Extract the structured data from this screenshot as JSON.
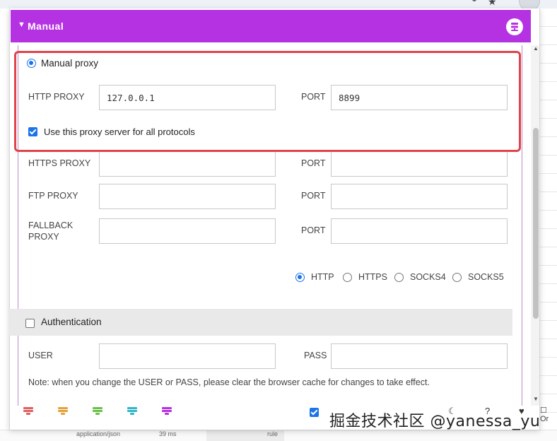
{
  "header": {
    "title": "Manual",
    "accent": "#b532e3"
  },
  "mode": {
    "manual_label": "Manual proxy",
    "selected": true
  },
  "http": {
    "label": "HTTP PROXY",
    "value": "127.0.0.1",
    "port_label": "PORT",
    "port_value": "8899"
  },
  "all_protocols": {
    "label": "Use this proxy server for all protocols",
    "checked": true
  },
  "https": {
    "label": "HTTPS PROXY",
    "port_label": "PORT",
    "value": "",
    "port_value": ""
  },
  "ftp": {
    "label": "FTP PROXY",
    "port_label": "PORT",
    "value": "",
    "port_value": ""
  },
  "fallback": {
    "label": "FALLBACK PROXY",
    "port_label": "PORT",
    "value": "",
    "port_value": ""
  },
  "fallback_types": {
    "options": [
      "HTTP",
      "HTTPS",
      "SOCKS4",
      "SOCKS5"
    ],
    "selected": "HTTP"
  },
  "auth": {
    "label": "Authentication",
    "checked": false,
    "user_label": "USER",
    "pass_label": "PASS",
    "note": "Note: when you change the USER or PASS, please clear the browser cache for changes to take effect."
  },
  "footer": {
    "icons": [
      {
        "name": "proxy-red-icon",
        "color": "#e06060"
      },
      {
        "name": "proxy-orange-icon",
        "color": "#e5a23a"
      },
      {
        "name": "proxy-green-icon",
        "color": "#6cc04a"
      },
      {
        "name": "proxy-teal-icon",
        "color": "#33b5c8"
      },
      {
        "name": "proxy-purple-icon",
        "color": "#b532e3"
      }
    ],
    "watermark": "掘金技术社区 @yanessa_yu"
  },
  "background": {
    "cell_1": "application/json",
    "cell_2": "39 ms",
    "cell_3": "rule",
    "right_label": "Or"
  },
  "colors": {
    "highlight_border": "#e0444b",
    "checkbox": "#1a73e8"
  }
}
